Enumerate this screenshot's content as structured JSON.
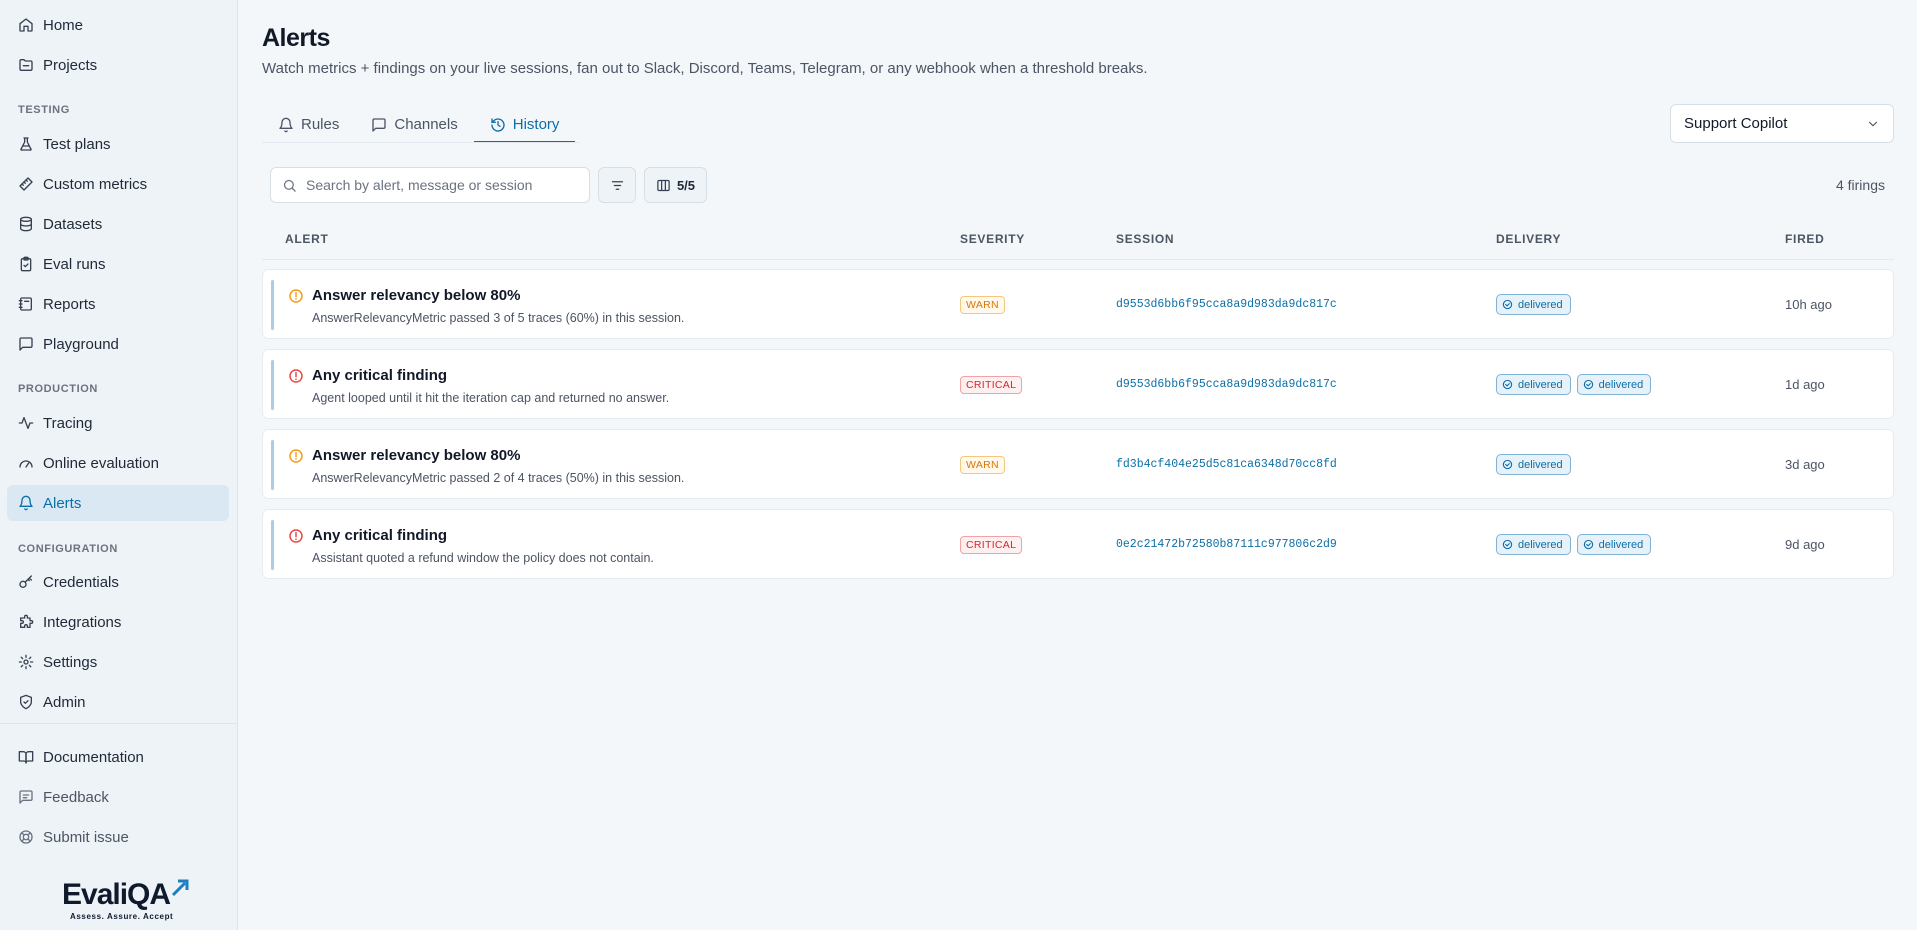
{
  "sidebar": {
    "top": [
      {
        "label": "Home",
        "icon": "home-icon"
      },
      {
        "label": "Projects",
        "icon": "folder-icon"
      }
    ],
    "sections": [
      {
        "title": "TESTING",
        "items": [
          {
            "label": "Test plans",
            "icon": "flask-icon"
          },
          {
            "label": "Custom metrics",
            "icon": "ruler-icon"
          },
          {
            "label": "Datasets",
            "icon": "database-icon"
          },
          {
            "label": "Eval runs",
            "icon": "clipboard-check-icon"
          },
          {
            "label": "Reports",
            "icon": "notebook-icon"
          },
          {
            "label": "Playground",
            "icon": "message-square-icon"
          }
        ]
      },
      {
        "title": "PRODUCTION",
        "items": [
          {
            "label": "Tracing",
            "icon": "activity-icon"
          },
          {
            "label": "Online evaluation",
            "icon": "gauge-icon"
          },
          {
            "label": "Alerts",
            "icon": "bell-icon",
            "active": true
          }
        ]
      },
      {
        "title": "CONFIGURATION",
        "items": [
          {
            "label": "Credentials",
            "icon": "key-icon"
          },
          {
            "label": "Integrations",
            "icon": "puzzle-icon"
          },
          {
            "label": "Settings",
            "icon": "gear-icon"
          },
          {
            "label": "Admin",
            "icon": "shield-check-icon"
          }
        ]
      }
    ],
    "bottom": [
      {
        "label": "Documentation",
        "icon": "book-icon"
      },
      {
        "label": "Feedback",
        "icon": "message-square-text-icon"
      },
      {
        "label": "Submit issue",
        "icon": "lifebuoy-icon"
      }
    ],
    "logo": {
      "word": "EvaliQA",
      "tagline": "Assess. Assure. Accept"
    }
  },
  "header": {
    "title": "Alerts",
    "subtitle": "Watch metrics + findings on your live sessions, fan out to Slack, Discord, Teams, Telegram, or any webhook when a threshold breaks."
  },
  "tabs": [
    {
      "label": "Rules",
      "icon": "bell-icon"
    },
    {
      "label": "Channels",
      "icon": "message-square-icon"
    },
    {
      "label": "History",
      "icon": "history-icon",
      "active": true
    }
  ],
  "project_select": {
    "value": "Support Copilot"
  },
  "toolbar": {
    "search_placeholder": "Search by alert, message or session",
    "columns_label": "5/5",
    "count_label": "4 firings"
  },
  "table": {
    "headers": {
      "alert": "ALERT",
      "severity": "SEVERITY",
      "session": "SESSION",
      "delivery": "DELIVERY",
      "fired": "FIRED"
    },
    "rows": [
      {
        "title": "Answer relevancy below 80%",
        "message": "AnswerRelevancyMetric passed 3 of 5 traces (60%) in this session.",
        "severity": "WARN",
        "level": "warn",
        "session": "d9553d6bb6f95cca8a9d983da9dc817c",
        "delivery": [
          "delivered"
        ],
        "fired": "10h ago"
      },
      {
        "title": "Any critical finding",
        "message": "Agent looped until it hit the iteration cap and returned no answer.",
        "severity": "CRITICAL",
        "level": "critical",
        "session": "d9553d6bb6f95cca8a9d983da9dc817c",
        "delivery": [
          "delivered",
          "delivered"
        ],
        "fired": "1d ago"
      },
      {
        "title": "Answer relevancy below 80%",
        "message": "AnswerRelevancyMetric passed 2 of 4 traces (50%) in this session.",
        "severity": "WARN",
        "level": "warn",
        "session": "fd3b4cf404e25d5c81ca6348d70cc8fd",
        "delivery": [
          "delivered"
        ],
        "fired": "3d ago"
      },
      {
        "title": "Any critical finding",
        "message": "Assistant quoted a refund window the policy does not contain.",
        "severity": "CRITICAL",
        "level": "critical",
        "session": "0e2c21472b72580b87111c977806c2d9",
        "delivery": [
          "delivered",
          "delivered"
        ],
        "fired": "9d ago"
      }
    ]
  },
  "colors": {
    "accent": "#0b6fa8",
    "warn": "#d97706",
    "critical": "#dc2626",
    "background": "#f3f7fa",
    "sidebar": "#eef3f7"
  }
}
